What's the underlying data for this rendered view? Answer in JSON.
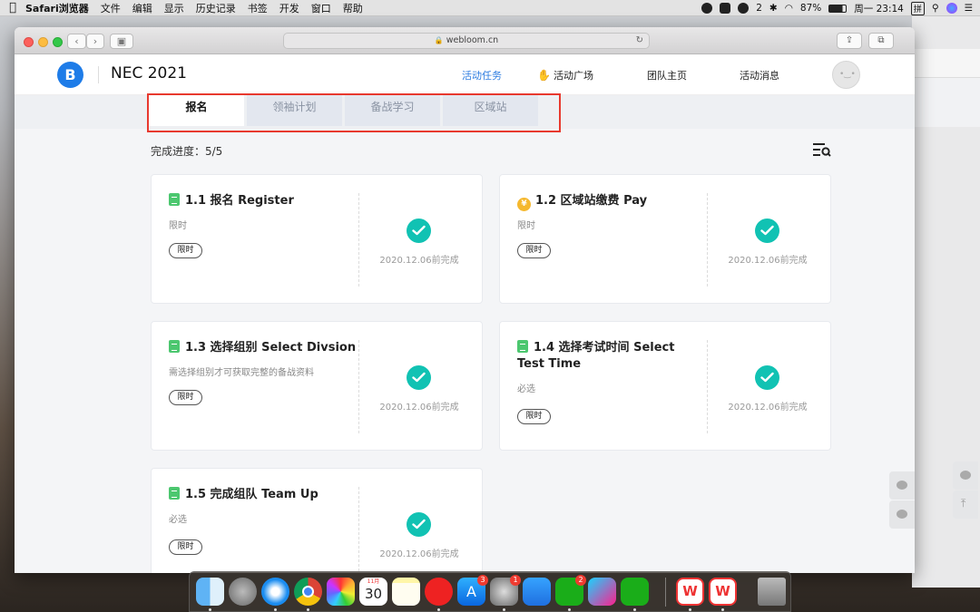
{
  "menubar": {
    "app": "Safari浏览器",
    "items": [
      "文件",
      "编辑",
      "显示",
      "历史记录",
      "书签",
      "开发",
      "窗口",
      "帮助"
    ],
    "wechat_count": "2",
    "battery": "87%",
    "clock": "周一 23:14",
    "input_method": "拼"
  },
  "browser": {
    "url": "webloom.cn"
  },
  "header": {
    "logo_letter": "B",
    "project_title": "NEC 2021",
    "nav": [
      {
        "label": "活动任务",
        "active": true
      },
      {
        "label": "活动广场",
        "icon": "waving-hand-icon"
      },
      {
        "label": "团队主页"
      },
      {
        "label": "活动消息"
      }
    ]
  },
  "tabs": [
    {
      "label": "报名",
      "active": true
    },
    {
      "label": "领袖计划"
    },
    {
      "label": "备战学习"
    },
    {
      "label": "区域站"
    }
  ],
  "progress": {
    "label": "完成进度：5/5"
  },
  "cards": [
    {
      "title": "1.1 报名 Register",
      "desc": "限时",
      "tag": "限时",
      "date": "2020.12.06前完成",
      "icon": "document-icon"
    },
    {
      "title": "1.2 区域站缴费 Pay",
      "desc": "限时",
      "tag": "限时",
      "date": "2020.12.06前完成",
      "icon": "yen-coin-icon",
      "icon_glyph": "¥"
    },
    {
      "title": "1.3 选择组别 Select Divsion",
      "desc": "需选择组别才可获取完整的备战资料",
      "tag": "限时",
      "date": "2020.12.06前完成",
      "icon": "document-icon"
    },
    {
      "title": "1.4 选择考试时间 Select Test Time",
      "desc": "必选",
      "tag": "限时",
      "date": "2020.12.06前完成",
      "icon": "document-icon"
    },
    {
      "title": "1.5 完成组队 Team Up",
      "desc": "必选",
      "tag": "限时",
      "date": "2020.12.06前完成",
      "icon": "document-icon"
    }
  ],
  "colors": {
    "accent": "#2d7ce0",
    "check": "#11c2b3",
    "highlight_box": "#e8392e",
    "doc_icon": "#4cc76f",
    "yen_icon": "#f5b82e"
  },
  "dock": {
    "calendar_month": "11月",
    "calendar_day": "30",
    "badges": {
      "app_store": "3",
      "system_prefs": "1",
      "wechat": "2"
    }
  }
}
